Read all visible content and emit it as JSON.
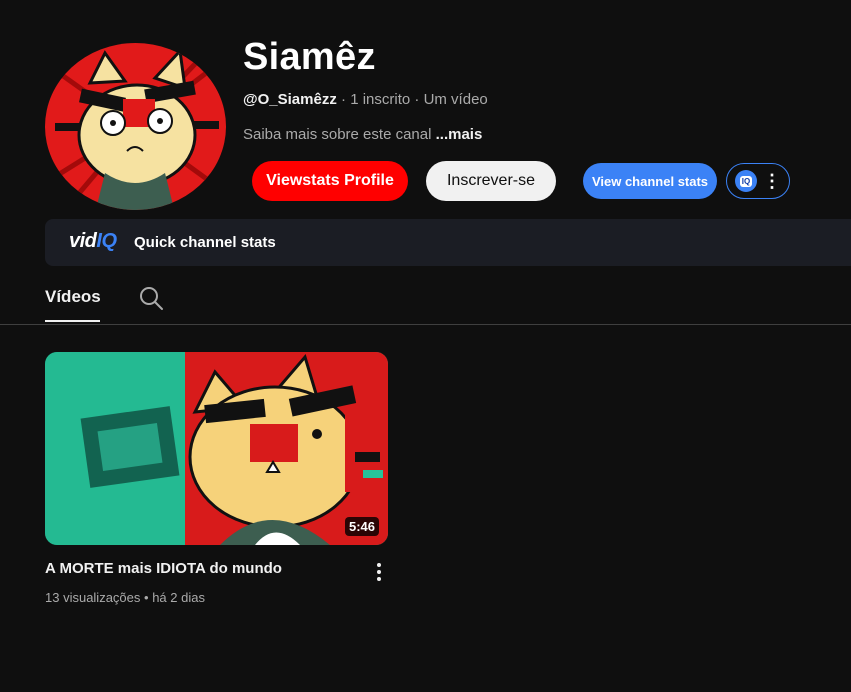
{
  "channel": {
    "name": "Siamêz",
    "handle": "@O_Siamêzz",
    "separator": "·",
    "subscribers": "1 inscrito",
    "videos_count": "Um vídeo",
    "about_text": "Saiba mais sobre este canal",
    "about_more": "...mais"
  },
  "buttons": {
    "viewstats": "Viewstats Profile",
    "subscribe": "Inscrever-se",
    "channel_stats": "View channel stats",
    "iq_badge": "IQ",
    "menu_dots": "⋮"
  },
  "vidiq": {
    "logo_vid": "vid",
    "logo_iq": "IQ",
    "label": "Quick channel stats"
  },
  "tabs": {
    "videos": "Vídeos",
    "search_icon": "search-icon"
  },
  "video": {
    "title": "A MORTE mais IDIOTA do mundo",
    "duration": "5:46",
    "views": "13 visualizações",
    "dot": "•",
    "age": "há 2 dias"
  },
  "colors": {
    "background": "#0f0f0f",
    "viewstats_red": "#ff0000",
    "vidiq_blue": "#3b82f6",
    "subscribe_bg": "#f1f1f1"
  }
}
